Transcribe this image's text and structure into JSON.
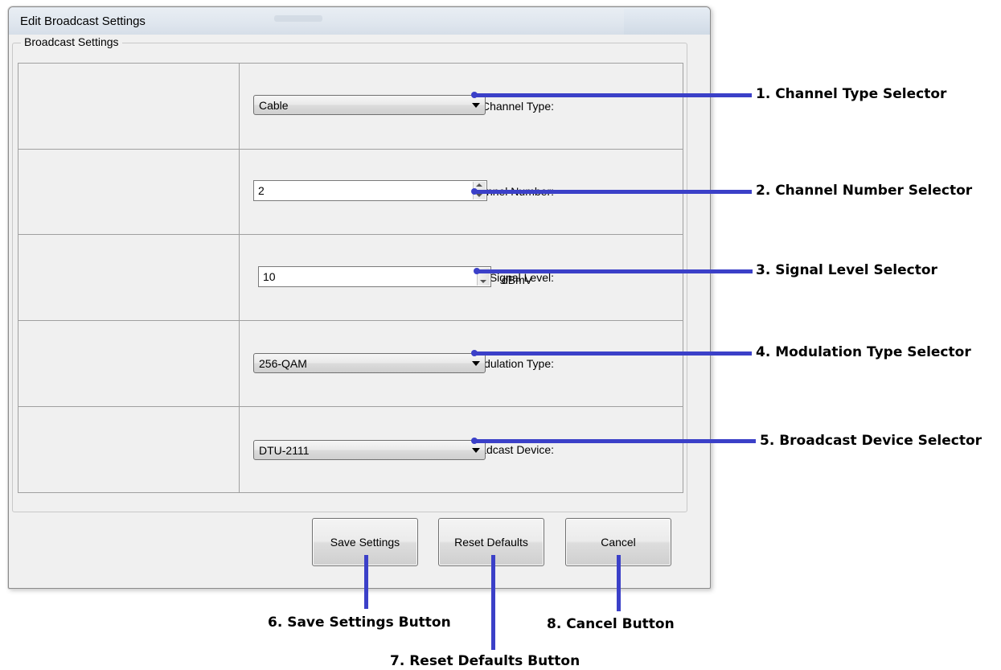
{
  "window": {
    "title": "Edit Broadcast Settings"
  },
  "group": {
    "legend": "Broadcast Settings"
  },
  "rows": [
    {
      "label": "Channel Type:",
      "value": "Cable"
    },
    {
      "label": "Channel Number:",
      "value": "2"
    },
    {
      "label": "Signal Level:",
      "value": "10",
      "unit": "dBmV"
    },
    {
      "label": "Modulation Type:",
      "value": "256-QAM"
    },
    {
      "label": "Broadcast Device:",
      "value": "DTU-2111"
    }
  ],
  "buttons": {
    "save": "Save Settings",
    "reset": "Reset Defaults",
    "cancel": "Cancel"
  },
  "annotations": [
    "1. Channel Type Selector",
    "2. Channel Number Selector",
    "3. Signal Level Selector",
    "4. Modulation Type Selector",
    "5. Broadcast Device Selector",
    "6. Save Settings Button",
    "7. Reset Defaults Button",
    "8. Cancel Button"
  ],
  "colors": {
    "annotation_line": "#3b40c8",
    "window_background": "#f0f0f0"
  }
}
